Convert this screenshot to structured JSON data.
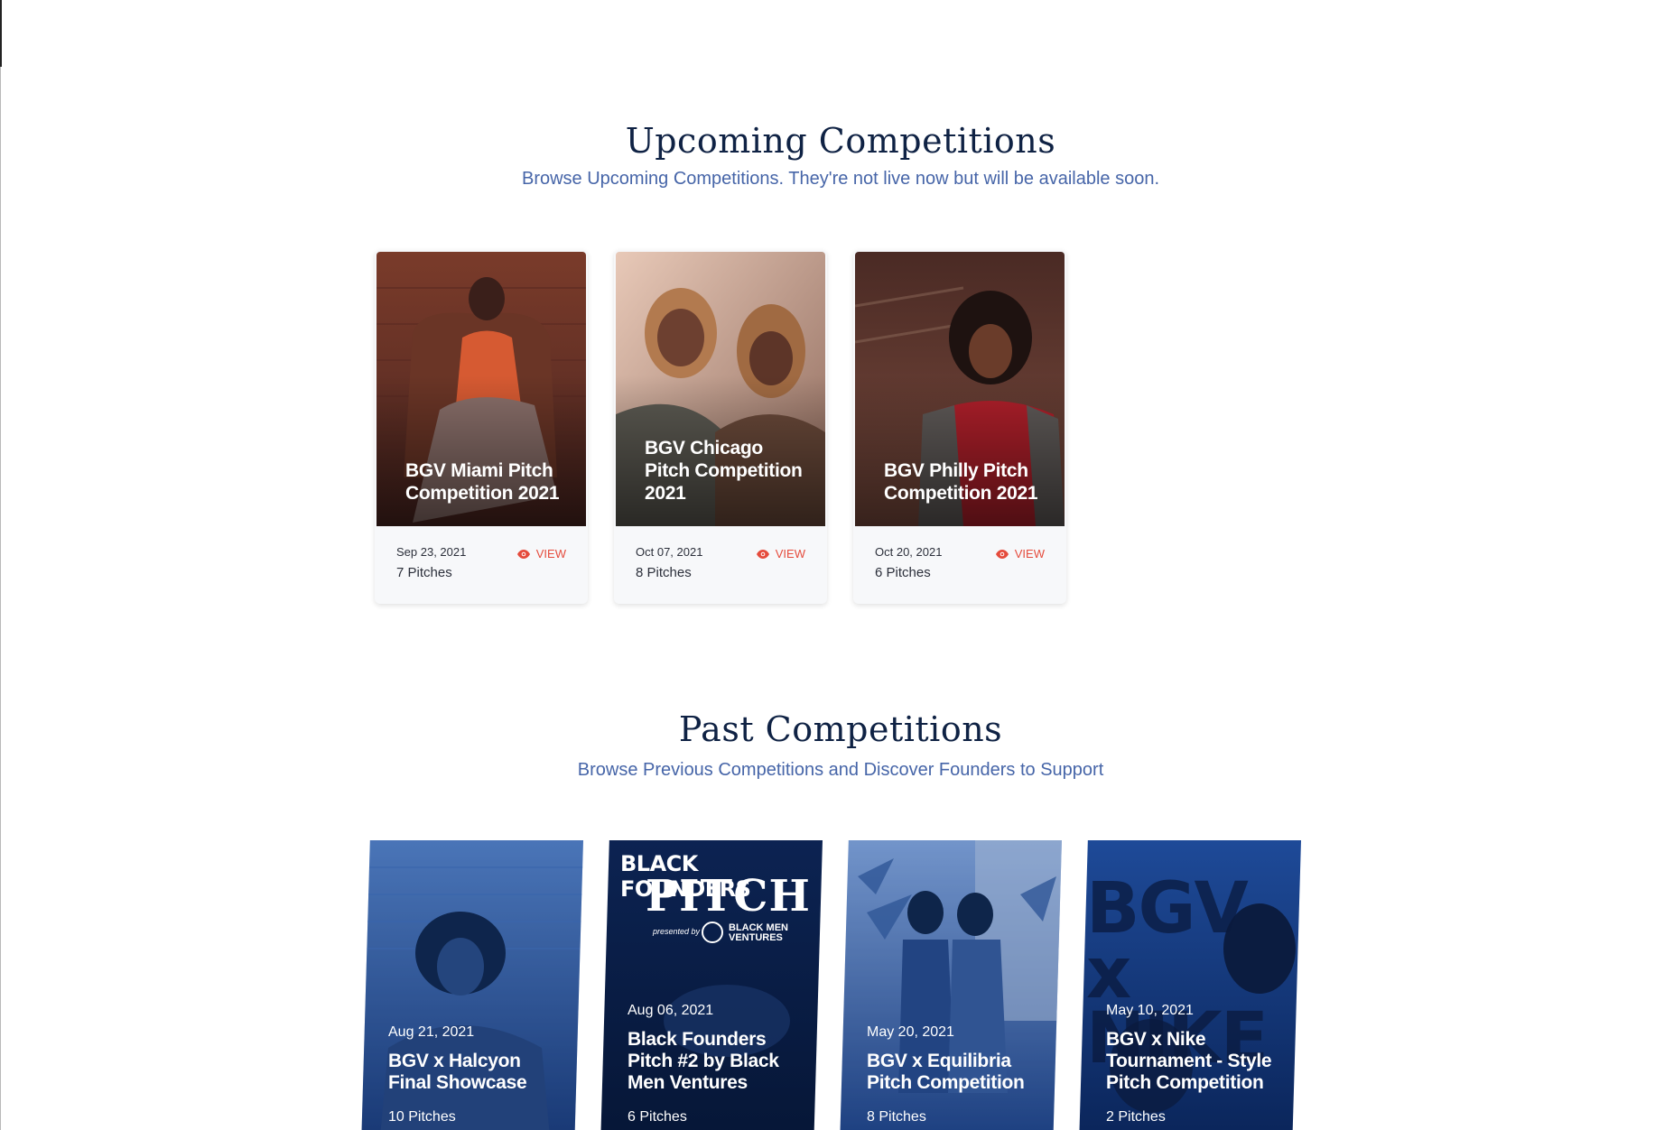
{
  "upcoming": {
    "title": "Upcoming Competitions",
    "subtitle": "Browse Upcoming Competitions. They're not live now but will be available soon.",
    "view_label": "VIEW",
    "cards": [
      {
        "title": "BGV Miami Pitch Competition 2021",
        "date": "Sep 23, 2021",
        "pitches": "7 Pitches"
      },
      {
        "title": "BGV Chicago Pitch Competition 2021",
        "date": "Oct 07, 2021",
        "pitches": "8 Pitches"
      },
      {
        "title": "BGV Philly Pitch Competition 2021",
        "date": "Oct 20, 2021",
        "pitches": "6 Pitches"
      }
    ]
  },
  "past": {
    "title": "Past Competitions",
    "subtitle": "Browse Previous Competitions and Discover Founders to Support",
    "cards": [
      {
        "title": "BGV x Halcyon Final Showcase",
        "date": "Aug 21, 2021",
        "pitches": "10 Pitches"
      },
      {
        "title": "Black Founders Pitch #2 by Black Men Ventures",
        "date": "Aug 06, 2021",
        "pitches": "6 Pitches",
        "poster_line1": "BLACK FOUNDERS",
        "poster_line2": "PITCH",
        "poster_presented": "presented by",
        "poster_org": "BLACK MEN VENTURES"
      },
      {
        "title": "BGV x Equilibria Pitch Competition",
        "date": "May 20, 2021",
        "pitches": "8 Pitches"
      },
      {
        "title": "BGV x Nike Tournament - Style Pitch Competition",
        "date": "May 10, 2021",
        "pitches": "2 Pitches",
        "poster_text": "BGV x NIKE"
      }
    ]
  },
  "icons": {
    "view": "eye-icon"
  },
  "colors": {
    "heading": "#0f2244",
    "subtitle": "#4665a8",
    "view": "#e54b3c",
    "past_tint": "#1c4a9c"
  }
}
